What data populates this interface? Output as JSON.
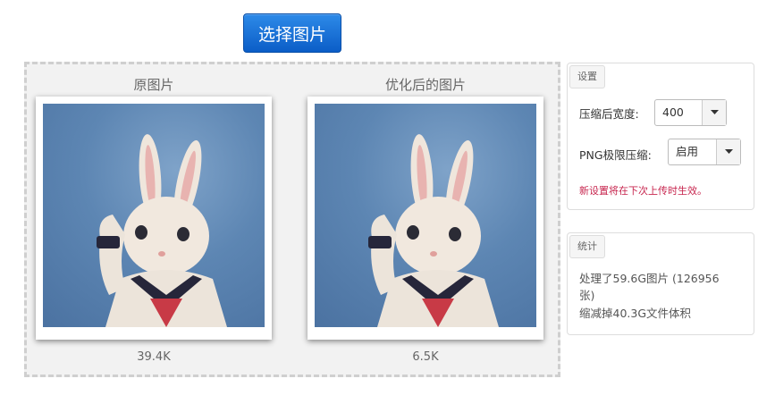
{
  "toolbar": {
    "select_button": "选择图片"
  },
  "preview": {
    "original": {
      "title": "原图片",
      "size": "39.4K"
    },
    "optimized": {
      "title": "优化后的图片",
      "size": "6.5K"
    }
  },
  "settings": {
    "tag": "设置",
    "width_label": "压缩后宽度:",
    "width_value": "400",
    "png_label": "PNG极限压缩:",
    "png_value": "启用",
    "note": "新设置将在下次上传时生效。"
  },
  "stats": {
    "tag": "统计",
    "processed_line1": "处理了59.6G图片 (126956",
    "processed_line2": "张)",
    "reduced": "缩减掉40.3G文件体积"
  },
  "colors": {
    "accent": "#0b5dc7",
    "note": "#c7254e"
  }
}
